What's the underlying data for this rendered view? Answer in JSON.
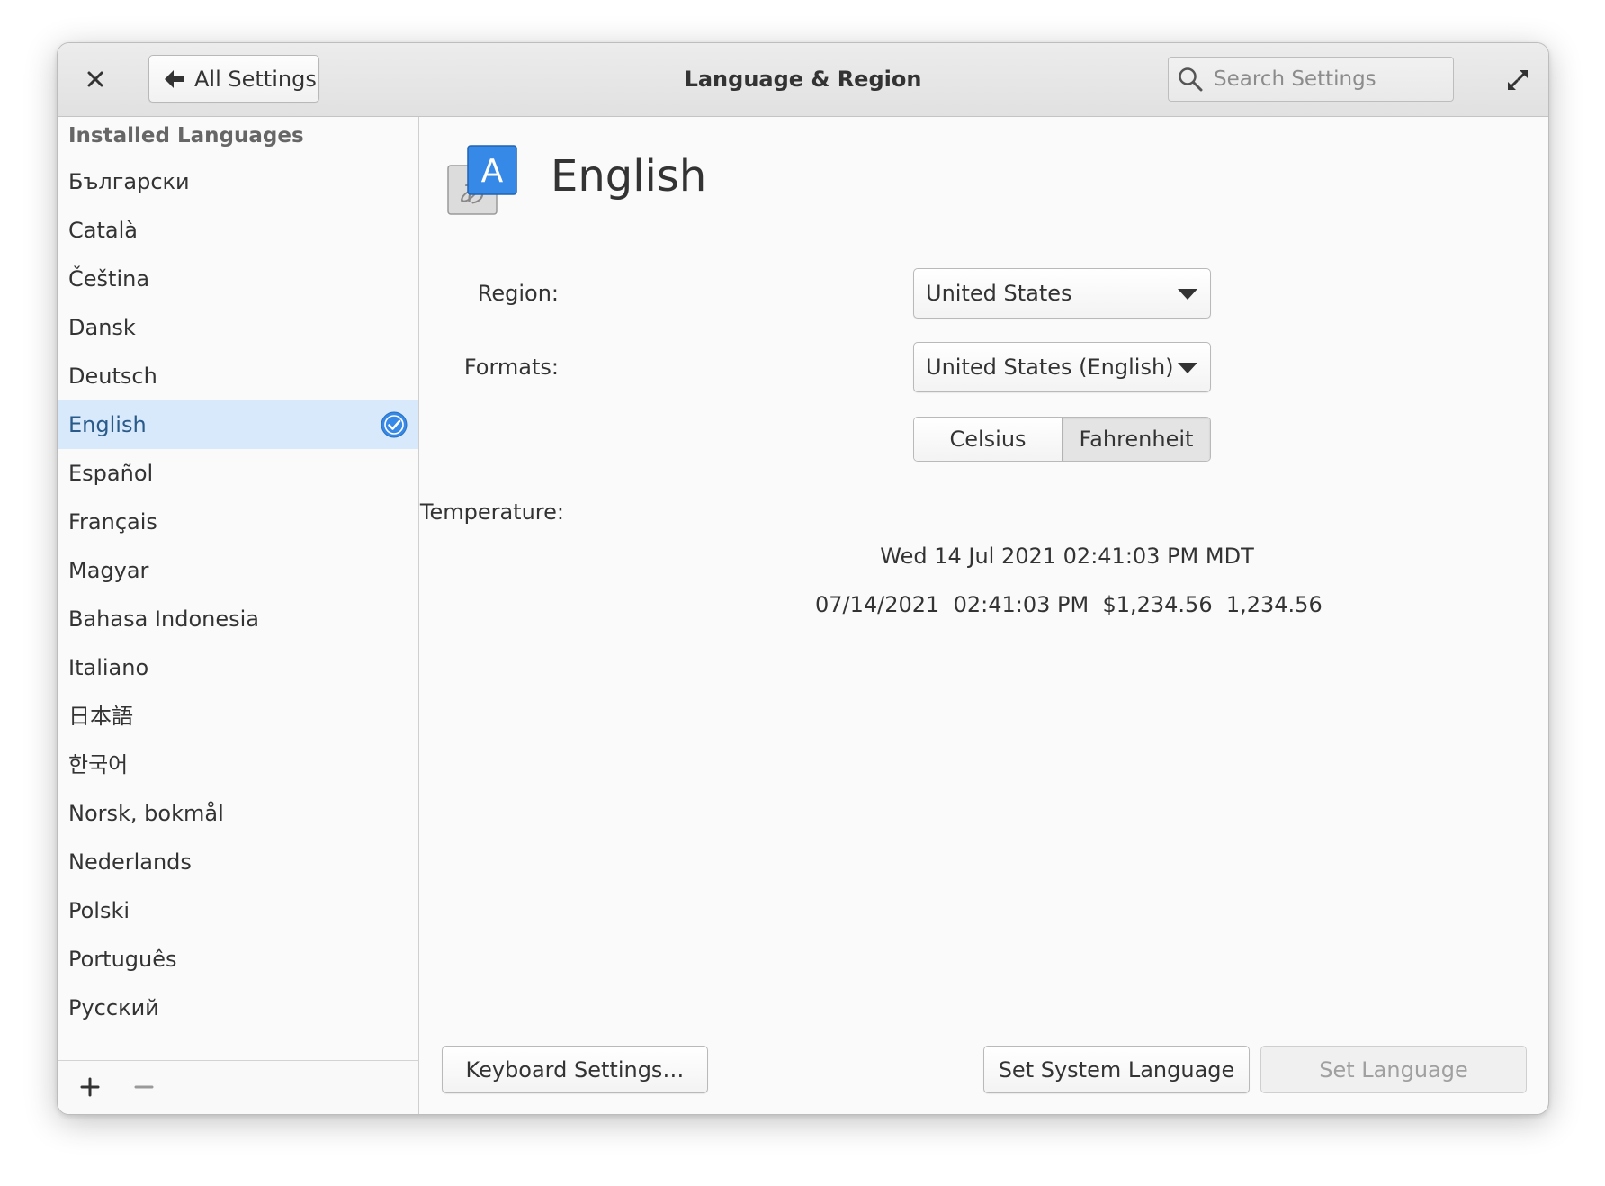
{
  "window": {
    "title": "Language & Region",
    "back_button_label": "All Settings",
    "search": {
      "placeholder": "Search Settings",
      "value": ""
    }
  },
  "sidebar": {
    "header": "Installed Languages",
    "items": [
      {
        "label": "Български",
        "selected": false
      },
      {
        "label": "Català",
        "selected": false
      },
      {
        "label": "Čeština",
        "selected": false
      },
      {
        "label": "Dansk",
        "selected": false
      },
      {
        "label": "Deutsch",
        "selected": false
      },
      {
        "label": "English",
        "selected": true
      },
      {
        "label": "Español",
        "selected": false
      },
      {
        "label": "Français",
        "selected": false
      },
      {
        "label": "Magyar",
        "selected": false
      },
      {
        "label": "Bahasa Indonesia",
        "selected": false
      },
      {
        "label": "Italiano",
        "selected": false
      },
      {
        "label": "日本語",
        "selected": false
      },
      {
        "label": "한국어",
        "selected": false
      },
      {
        "label": "Norsk, bokmål",
        "selected": false
      },
      {
        "label": "Nederlands",
        "selected": false
      },
      {
        "label": "Polski",
        "selected": false
      },
      {
        "label": "Português",
        "selected": false
      },
      {
        "label": "Русский",
        "selected": false
      }
    ],
    "footer": {
      "add_symbol": "+",
      "remove_symbol": "−"
    }
  },
  "content": {
    "language_title": "English",
    "icon": {
      "front_letter": "A",
      "back_glyph": "あ"
    },
    "region": {
      "label": "Region:",
      "value": "United States"
    },
    "formats": {
      "label": "Formats:",
      "value": "United States (English)"
    },
    "temperature": {
      "label": "Temperature:",
      "options": [
        "Celsius",
        "Fahrenheit"
      ],
      "selected": "Fahrenheit"
    },
    "preview": {
      "datetime": "Wed 14 Jul 2021 02:41:03 PM MDT",
      "formats": "07/14/2021  02:41:03 PM  $1,234.56  1,234.56"
    },
    "buttons": {
      "keyboard_settings": "Keyboard Settings…",
      "set_system_language": "Set System Language",
      "set_language": "Set Language"
    }
  },
  "colors": {
    "accent": "#3689e6",
    "selection_bg": "#d7e9fb",
    "selection_text": "#2a5a8a",
    "window_bg": "#fafafa",
    "titlebar_bg": "#e6e6e6"
  }
}
